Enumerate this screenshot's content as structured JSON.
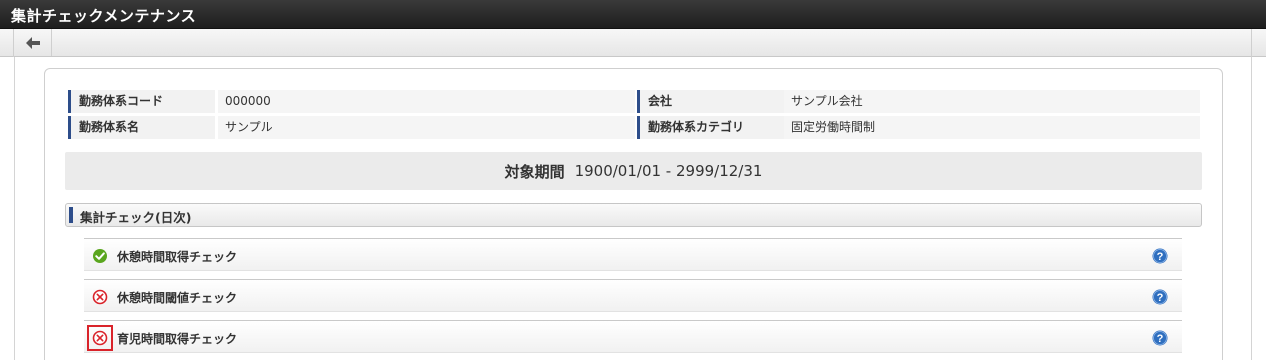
{
  "window": {
    "title": "集計チェックメンテナンス"
  },
  "toolbar": {
    "back_icon": "arrow-left-icon"
  },
  "info": {
    "work_code_label": "勤務体系コード",
    "work_code_value": "000000",
    "company_label": "会社",
    "company_value": "サンプル会社",
    "work_name_label": "勤務体系名",
    "work_name_value": "サンプル",
    "category_label": "勤務体系カテゴリ",
    "category_value": "固定労働時間制"
  },
  "period": {
    "label": "対象期間",
    "value": "1900/01/01 - 2999/12/31"
  },
  "section": {
    "title": "集計チェック(日次)"
  },
  "checks": [
    {
      "name": "休憩時間取得チェック",
      "status": "ok",
      "icon": "check-circle-icon"
    },
    {
      "name": "休憩時間閾値チェック",
      "status": "ng",
      "icon": "x-circle-icon"
    },
    {
      "name": "育児時間取得チェック",
      "status": "ng",
      "icon": "x-circle-icon"
    }
  ],
  "colors": {
    "ok": "#5aa61e",
    "ng": "#d9232a",
    "help": "#2f6fbf",
    "accent": "#2d4d8a"
  }
}
